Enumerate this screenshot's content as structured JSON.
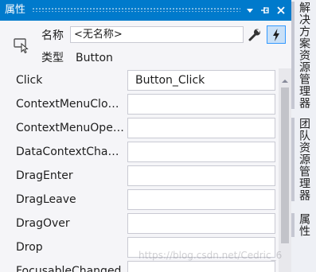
{
  "window": {
    "title": "属性"
  },
  "header": {
    "name_label": "名称",
    "name_value": "<无名称>",
    "type_label": "类型",
    "type_value": "Button"
  },
  "events": [
    {
      "name": "Click",
      "handler": "Button_Click"
    },
    {
      "name": "ContextMenuClosing",
      "handler": ""
    },
    {
      "name": "ContextMenuOpening",
      "handler": ""
    },
    {
      "name": "DataContextChanged",
      "handler": ""
    },
    {
      "name": "DragEnter",
      "handler": ""
    },
    {
      "name": "DragLeave",
      "handler": ""
    },
    {
      "name": "DragOver",
      "handler": ""
    },
    {
      "name": "Drop",
      "handler": ""
    },
    {
      "name": "FocusableChanged",
      "handler": ""
    }
  ],
  "dock_tabs": [
    "解决方案资源管理器",
    "团队资源管理器",
    "属性"
  ],
  "watermark": "https://blog.csdn.net/Cedric_6",
  "colors": {
    "titlebar": "#007acc",
    "selected_toggle": "#c9e0f7",
    "selected_border": "#3399ff"
  },
  "icons": {
    "dropdown": "chevron-down-icon",
    "pin": "pin-icon",
    "close": "close-icon",
    "object": "cursor-select-icon",
    "properties": "wrench-icon",
    "events": "lightning-icon"
  }
}
